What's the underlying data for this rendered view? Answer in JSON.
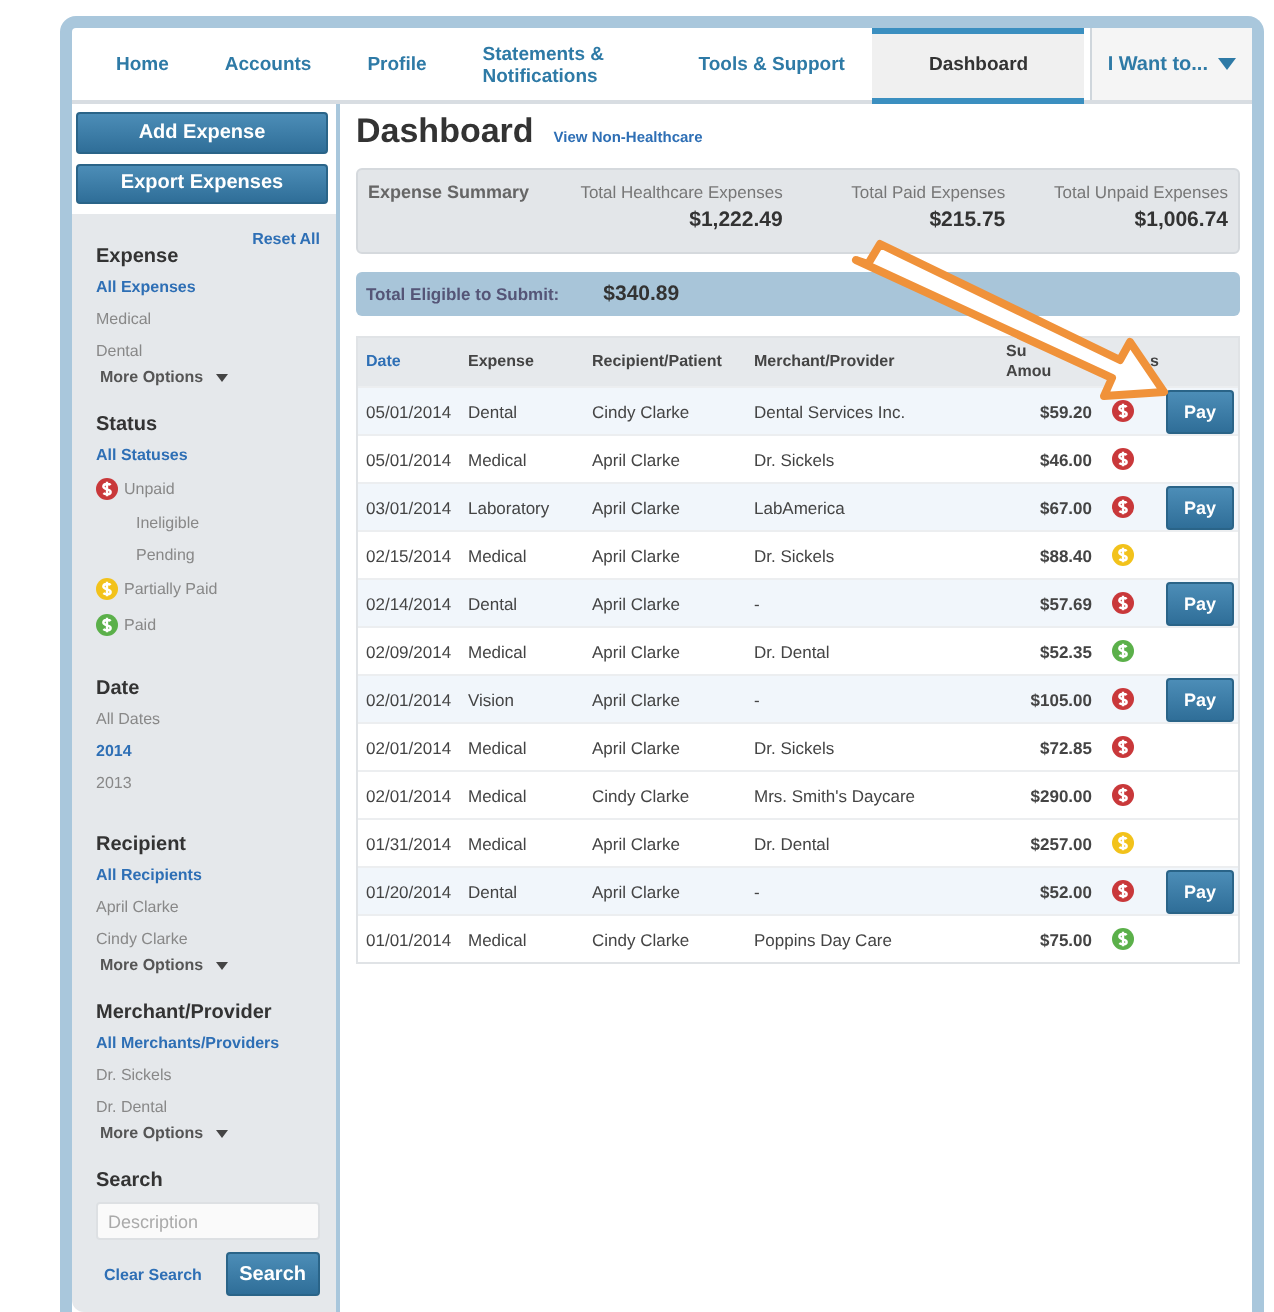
{
  "nav": {
    "tabs": [
      {
        "label": "Home",
        "selected": false
      },
      {
        "label": "Accounts",
        "selected": false
      },
      {
        "label": "Profile",
        "selected": false
      },
      {
        "label": "Statements & Notifications",
        "selected": false
      },
      {
        "label": "Tools & Support",
        "selected": false
      },
      {
        "label": "Dashboard",
        "selected": true
      }
    ],
    "menu": "I Want to..."
  },
  "sidebar": {
    "buttons": [
      "Add Expense",
      "Export Expenses"
    ],
    "reset": "Reset All",
    "sections": [
      {
        "title": "Expense",
        "items": [
          {
            "label": "All Expenses",
            "selected": true
          },
          {
            "label": "Medical",
            "selected": false
          },
          {
            "label": "Dental",
            "selected": false
          }
        ],
        "more": "More Options"
      },
      {
        "title": "Status",
        "items": [
          {
            "label": "All Statuses",
            "selected": true
          },
          {
            "label": "Unpaid",
            "selected": false,
            "color": "#c9383a",
            "children": [
              {
                "label": "Ineligible",
                "selected": false
              },
              {
                "label": "Pending",
                "selected": false
              }
            ]
          },
          {
            "label": "Partially Paid",
            "selected": false,
            "color": "#f2c21b"
          },
          {
            "label": "Paid",
            "selected": false,
            "color": "#5bb04a"
          }
        ]
      },
      {
        "title": "Date",
        "items": [
          {
            "label": "All Dates",
            "selected": false
          },
          {
            "label": "2014",
            "selected": true
          },
          {
            "label": "2013",
            "selected": false
          }
        ]
      },
      {
        "title": "Recipient",
        "items": [
          {
            "label": "All Recipients",
            "selected": true
          },
          {
            "label": "April Clarke",
            "selected": false
          },
          {
            "label": "Cindy Clarke",
            "selected": false
          }
        ],
        "more": "More Options"
      },
      {
        "title": "Merchant/Provider",
        "items": [
          {
            "label": "All Merchants/Providers",
            "selected": true
          },
          {
            "label": "Dr. Sickels",
            "selected": false
          },
          {
            "label": "Dr. Dental",
            "selected": false
          }
        ],
        "more": "More Options"
      }
    ],
    "search": {
      "title": "Search",
      "placeholder": "Description",
      "clear": "Clear Search",
      "button": "Search"
    }
  },
  "main": {
    "title": "Dashboard",
    "link": "View Non-Healthcare",
    "summary": {
      "label": "Expense Summary",
      "totals": [
        {
          "label": "Total Healthcare Expenses",
          "value": "$1,222.49"
        },
        {
          "label": "Total Paid Expenses",
          "value": "$215.75"
        },
        {
          "label": "Total Unpaid Expenses",
          "value": "$1,006.74"
        }
      ]
    },
    "eligible": {
      "label": "Total Eligible to Submit:",
      "value": "$340.89"
    },
    "table": {
      "columns": [
        {
          "lines": [
            "Date"
          ]
        },
        {
          "lines": [
            "Expense"
          ]
        },
        {
          "lines": [
            "Recipient/Patient"
          ]
        },
        {
          "lines": [
            "Merchant/Provider"
          ]
        },
        {
          "lines": [
            "Su",
            "Amou"
          ]
        },
        {
          "lines": [
            "s"
          ]
        }
      ],
      "rows": [
        {
          "date": "05/01/2014",
          "expense": "Dental",
          "recipient": "Cindy Clarke",
          "merchant": "Dental Services Inc.",
          "amount": "$59.20",
          "color": "#c9383a",
          "action": "Pay"
        },
        {
          "date": "05/01/2014",
          "expense": "Medical",
          "recipient": "April Clarke",
          "merchant": "Dr. Sickels",
          "amount": "$46.00",
          "color": "#c9383a"
        },
        {
          "date": "03/01/2014",
          "expense": "Laboratory",
          "recipient": "April Clarke",
          "merchant": "LabAmerica",
          "amount": "$67.00",
          "color": "#c9383a",
          "action": "Pay"
        },
        {
          "date": "02/15/2014",
          "expense": "Medical",
          "recipient": "April Clarke",
          "merchant": "Dr. Sickels",
          "amount": "$88.40",
          "color": "#f2c21b"
        },
        {
          "date": "02/14/2014",
          "expense": "Dental",
          "recipient": "April Clarke",
          "merchant": "-",
          "amount": "$57.69",
          "color": "#c9383a",
          "action": "Pay"
        },
        {
          "date": "02/09/2014",
          "expense": "Medical",
          "recipient": "April Clarke",
          "merchant": "Dr. Dental",
          "amount": "$52.35",
          "color": "#5bb04a"
        },
        {
          "date": "02/01/2014",
          "expense": "Vision",
          "recipient": "April Clarke",
          "merchant": "-",
          "amount": "$105.00",
          "color": "#c9383a",
          "action": "Pay"
        },
        {
          "date": "02/01/2014",
          "expense": "Medical",
          "recipient": "April Clarke",
          "merchant": "Dr. Sickels",
          "amount": "$72.85",
          "color": "#c9383a"
        },
        {
          "date": "02/01/2014",
          "expense": "Medical",
          "recipient": "Cindy Clarke",
          "merchant": "Mrs. Smith's Daycare",
          "amount": "$290.00",
          "color": "#c9383a"
        },
        {
          "date": "01/31/2014",
          "expense": "Medical",
          "recipient": "April Clarke",
          "merchant": "Dr. Dental",
          "amount": "$257.00",
          "color": "#f2c21b"
        },
        {
          "date": "01/20/2014",
          "expense": "Dental",
          "recipient": "April Clarke",
          "merchant": "-",
          "amount": "$52.00",
          "color": "#c9383a",
          "action": "Pay"
        },
        {
          "date": "01/01/2014",
          "expense": "Medical",
          "recipient": "Cindy Clarke",
          "merchant": "Poppins Day Care",
          "amount": "$75.00",
          "color": "#5bb04a"
        }
      ]
    }
  }
}
